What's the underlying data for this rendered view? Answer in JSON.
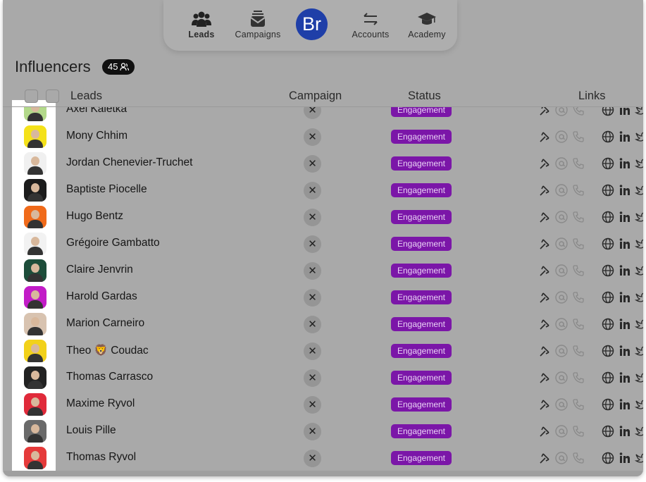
{
  "nav": {
    "items": [
      {
        "label": "Leads",
        "icon": "users-icon",
        "active": true
      },
      {
        "label": "Campaigns",
        "icon": "inbox-icon",
        "active": false
      },
      {
        "label": "Accounts",
        "icon": "swap-arrows-icon",
        "active": false
      },
      {
        "label": "Academy",
        "icon": "graduation-cap-icon",
        "active": false
      }
    ],
    "brand": "Br"
  },
  "page": {
    "title": "Influencers",
    "count": "45"
  },
  "table": {
    "headers": {
      "leads": "Leads",
      "campaign": "Campaign",
      "status": "Status",
      "links": "Links"
    },
    "rows": [
      {
        "name": "Axel Kaletka",
        "status": "Engagement"
      },
      {
        "name": "Mony Chhim",
        "status": "Engagement"
      },
      {
        "name": "Jordan Chenevier-Truchet",
        "status": "Engagement"
      },
      {
        "name": "Baptiste Piocelle",
        "status": "Engagement"
      },
      {
        "name": "Hugo Bentz",
        "status": "Engagement"
      },
      {
        "name": "Grégoire Gambatto",
        "status": "Engagement"
      },
      {
        "name": "Claire Jenvrin",
        "status": "Engagement"
      },
      {
        "name": "Harold Gardas",
        "status": "Engagement"
      },
      {
        "name": "Marion Carneiro",
        "status": "Engagement"
      },
      {
        "name": "Theo 🦁 Coudac",
        "status": "Engagement"
      },
      {
        "name": "Thomas Carrasco",
        "status": "Engagement"
      },
      {
        "name": "Maxime Ryvol",
        "status": "Engagement"
      },
      {
        "name": "Louis Pille",
        "status": "Engagement"
      },
      {
        "name": "Thomas Ryvol",
        "status": "Engagement"
      }
    ]
  },
  "colors": {
    "status_bg": "#7b16a8",
    "brand": "#1f3fa8"
  }
}
